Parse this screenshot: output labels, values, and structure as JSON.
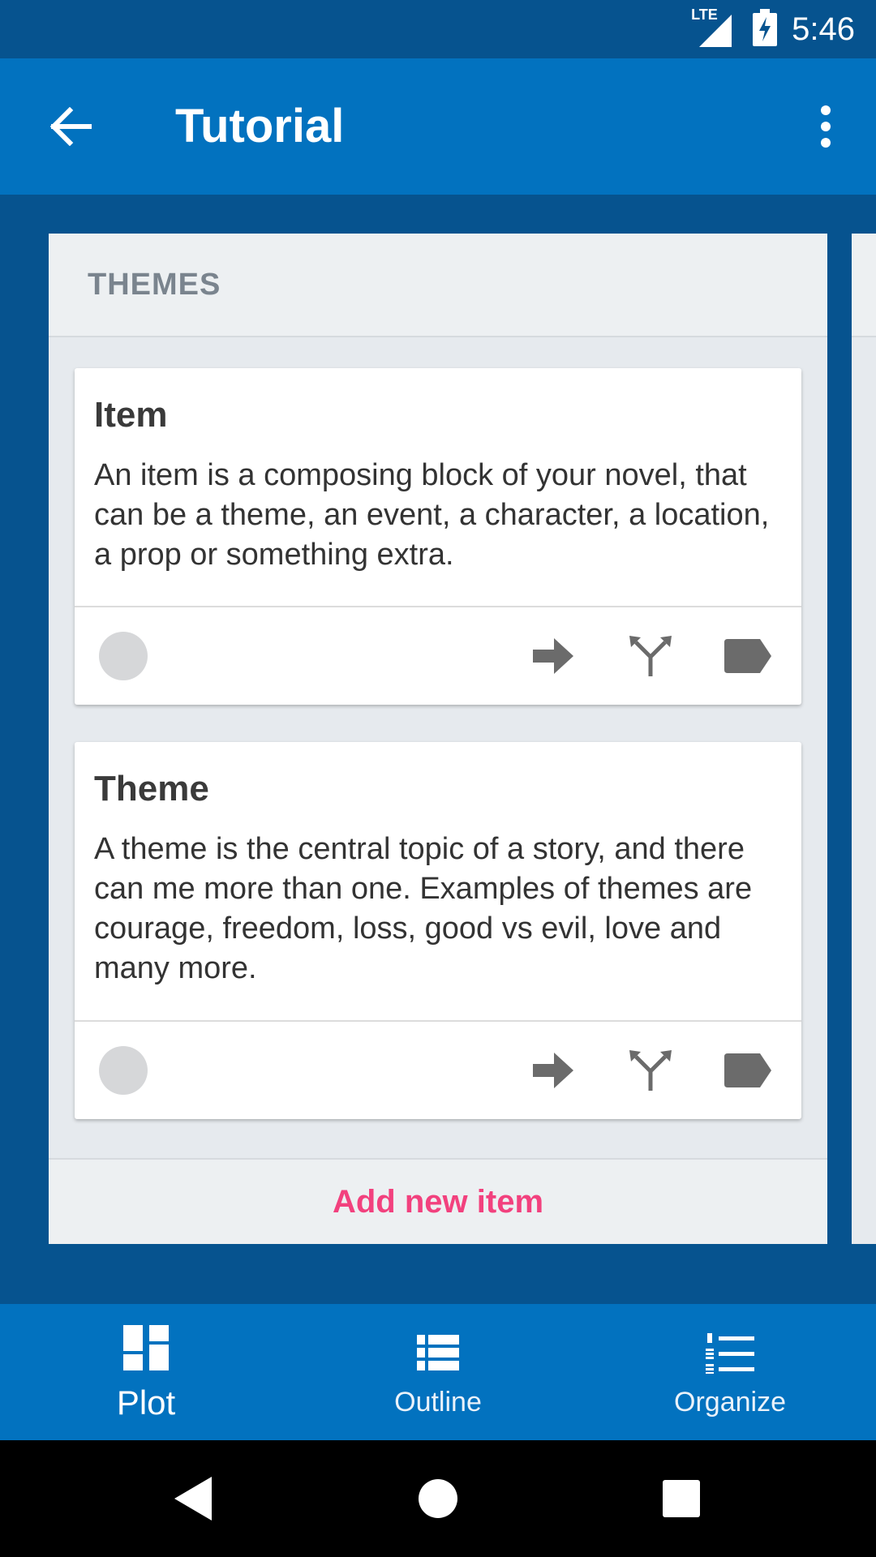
{
  "status_bar": {
    "network": "LTE",
    "time": "5:46"
  },
  "app_bar": {
    "title": "Tutorial"
  },
  "column": {
    "title": "THEMES",
    "cards": [
      {
        "title": "Item",
        "text": "An item is a composing block of your novel, that can be a theme, an event, a character, a location, a prop or something extra."
      },
      {
        "title": "Theme",
        "text": "A theme is the central topic of a story, and there can me more than one. Examples of themes are courage, freedom, loss, good vs evil, love and many more."
      }
    ],
    "add_label": "Add new item"
  },
  "bottom_nav": {
    "items": [
      {
        "label": "Plot",
        "icon": "plot-grid-icon",
        "active": true
      },
      {
        "label": "Outline",
        "icon": "list-icon",
        "active": false
      },
      {
        "label": "Organize",
        "icon": "numbered-list-icon",
        "active": false
      }
    ]
  },
  "colors": {
    "app_bar": "#0272BF",
    "background": "#06538F",
    "accent": "#F2417E"
  }
}
